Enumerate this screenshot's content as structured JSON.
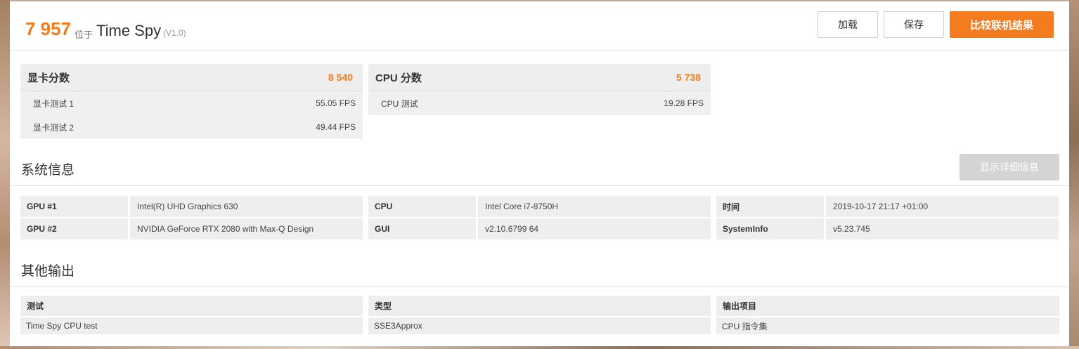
{
  "header": {
    "score": "7 957",
    "score_separator": "位于",
    "benchmark": "Time Spy",
    "version": "(V1.0)",
    "buttons": {
      "load": "加载",
      "save": "保存",
      "compare": "比较联机结果"
    }
  },
  "scores": {
    "gpu": {
      "title": "显卡分数",
      "value": "8 540",
      "tests": [
        {
          "label": "显卡测试 1",
          "value": "55.05 FPS"
        },
        {
          "label": "显卡测试 2",
          "value": "49.44 FPS"
        }
      ]
    },
    "cpu": {
      "title": "CPU 分数",
      "value": "5 738",
      "tests": [
        {
          "label": "CPU 测试",
          "value": "19.28 FPS"
        }
      ]
    }
  },
  "system_info": {
    "title": "系统信息",
    "details_button": "显示详细信息",
    "columns": [
      [
        {
          "key": "GPU #1",
          "value": "Intel(R) UHD Graphics 630"
        },
        {
          "key": "GPU #2",
          "value": "NVIDIA GeForce RTX 2080 with Max-Q Design"
        }
      ],
      [
        {
          "key": "CPU",
          "value": "Intel Core i7-8750H"
        },
        {
          "key": "GUI",
          "value": "v2.10.6799 64"
        }
      ],
      [
        {
          "key": "时间",
          "value": "2019-10-17 21:17 +01:00"
        },
        {
          "key": "SystemInfo",
          "value": "v5.23.745"
        }
      ]
    ]
  },
  "other_output": {
    "title": "其他输出",
    "columns": [
      {
        "header": "测试",
        "value": "Time Spy CPU test"
      },
      {
        "header": "类型",
        "value": "SSE3Approx"
      },
      {
        "header": "输出项目",
        "value": "CPU 指令集"
      }
    ]
  },
  "colors": {
    "accent": "#f47c1f",
    "disabled_button": "#d4d4d4"
  }
}
